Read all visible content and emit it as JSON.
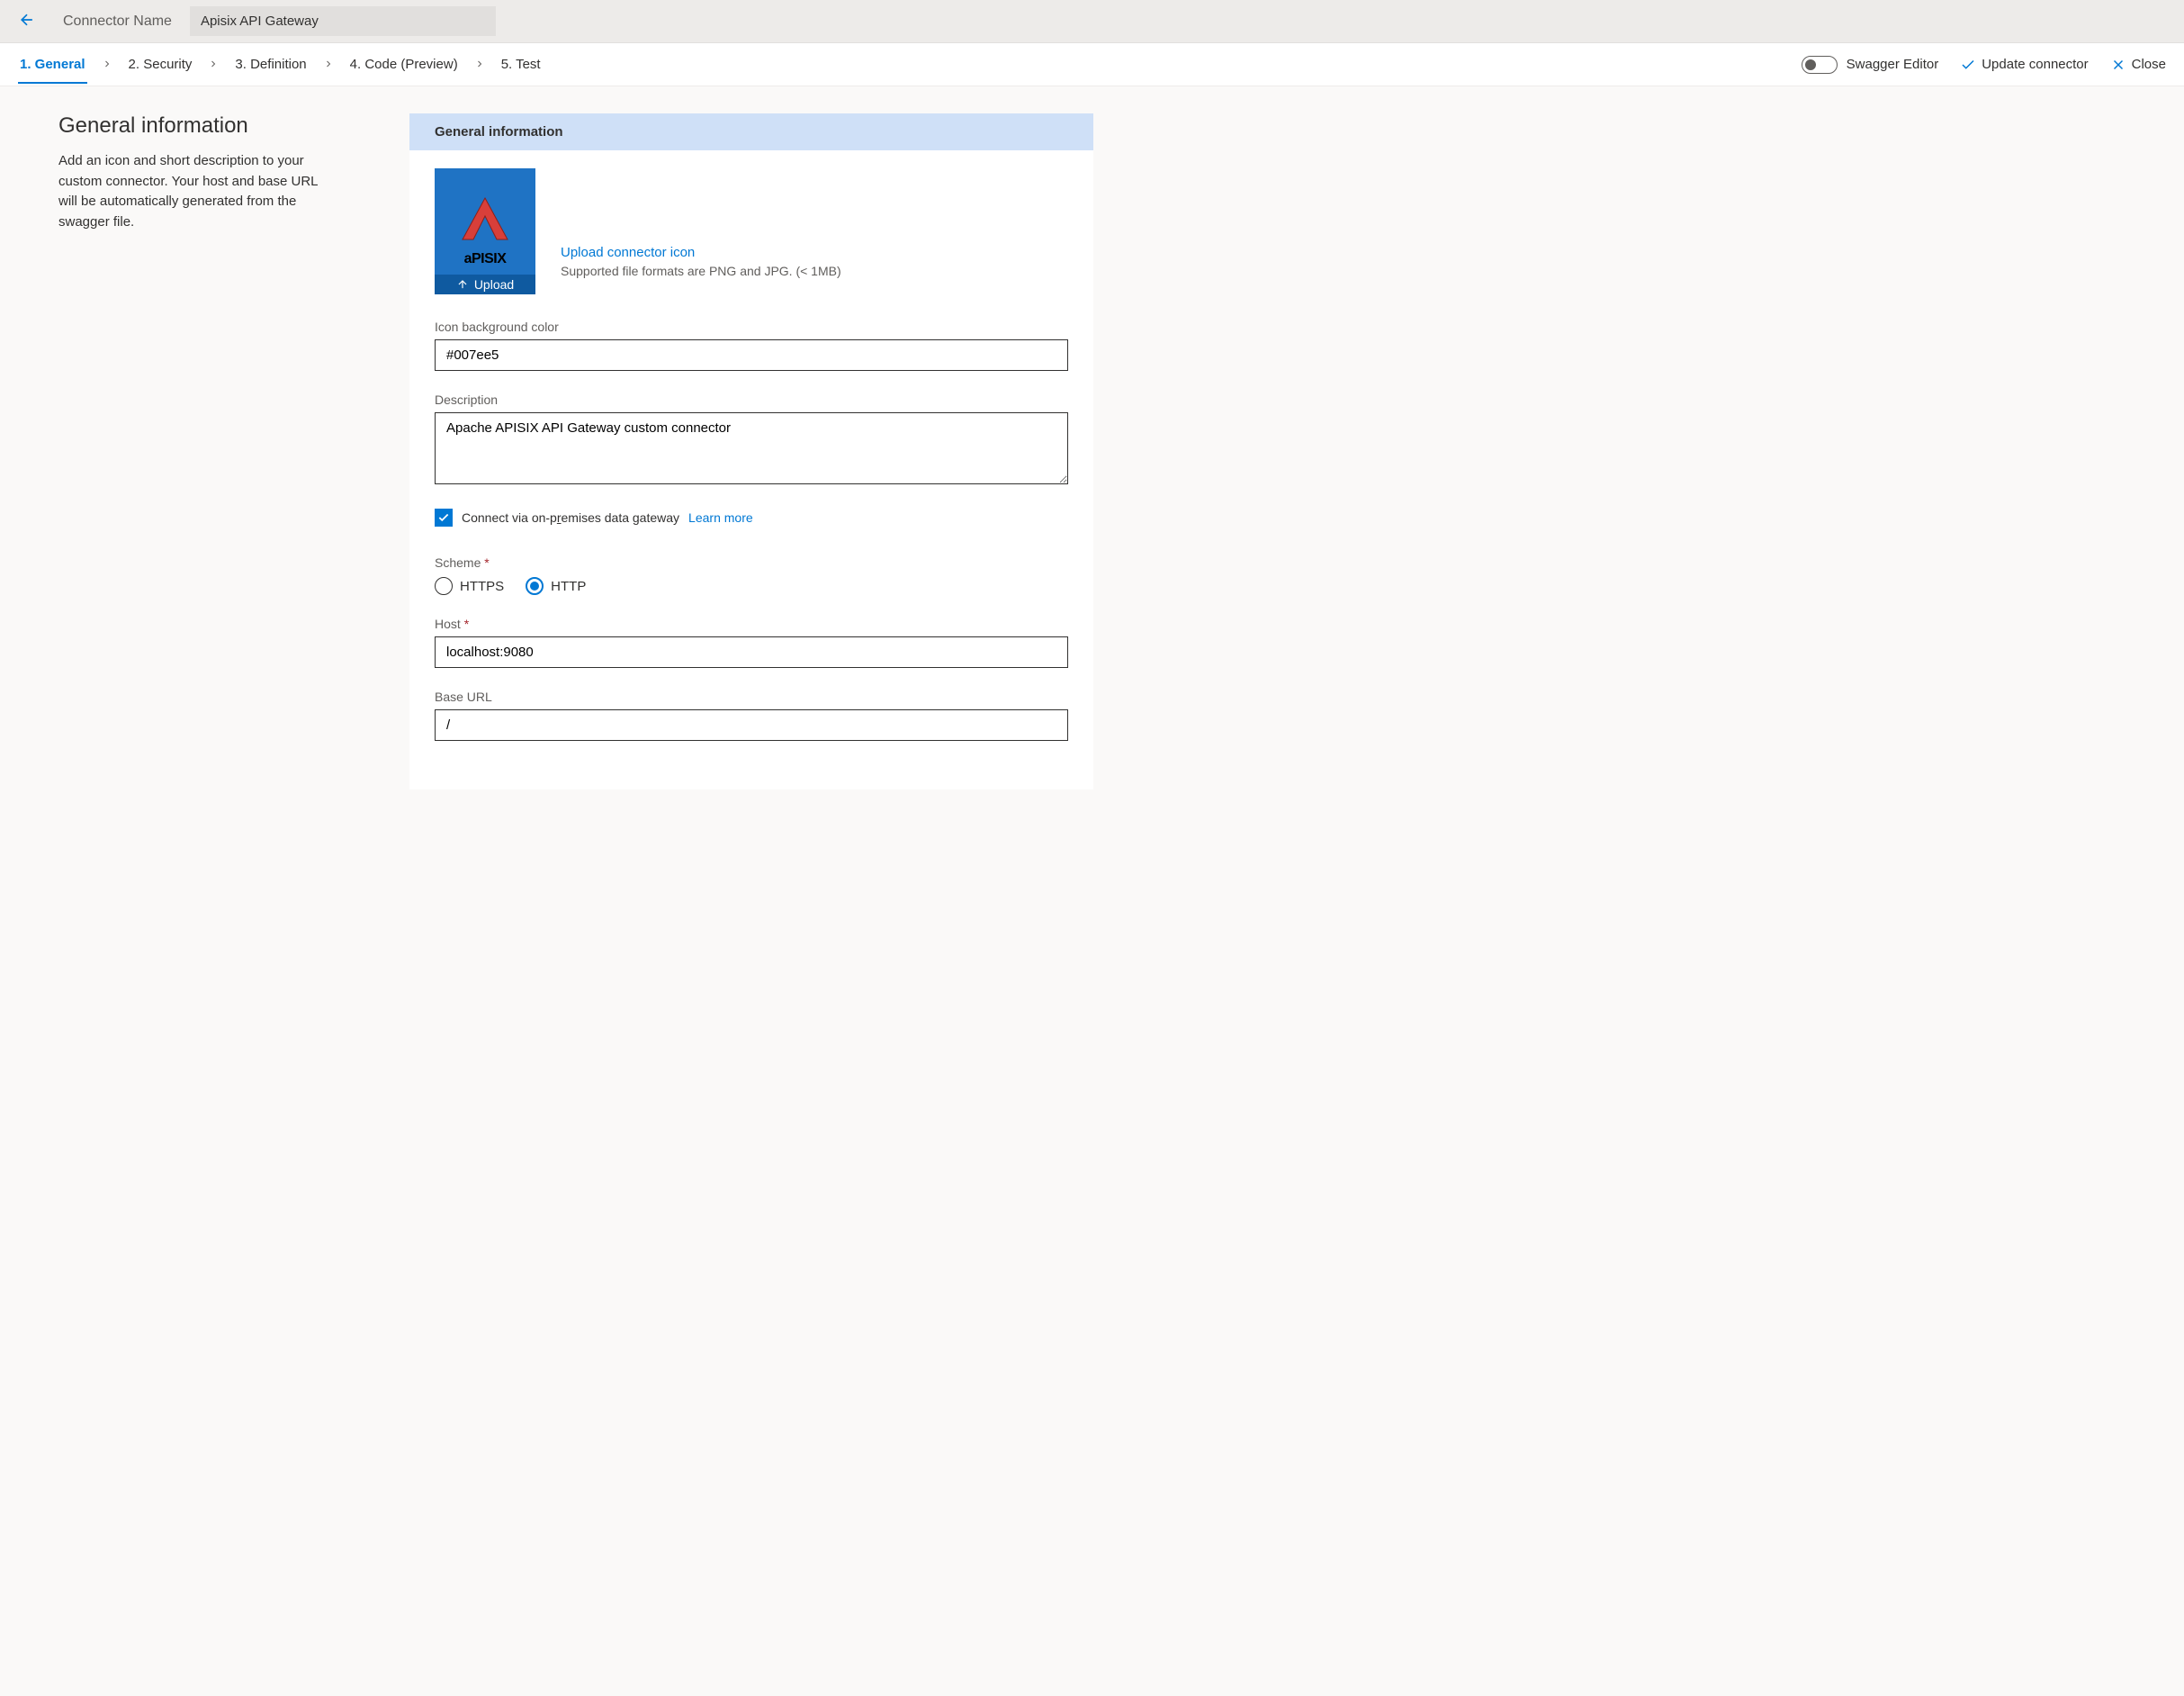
{
  "header": {
    "connector_name_label": "Connector Name",
    "connector_name_value": "Apisix API Gateway"
  },
  "tabs": {
    "general": "1. General",
    "security": "2. Security",
    "definition": "3. Definition",
    "code": "4. Code (Preview)",
    "test": "5. Test"
  },
  "actions": {
    "swagger_editor": "Swagger Editor",
    "update_connector": "Update connector",
    "close": "Close"
  },
  "left": {
    "heading": "General information",
    "description": "Add an icon and short description to your custom connector. Your host and base URL will be automatically generated from the swagger file."
  },
  "form": {
    "section_title": "General information",
    "upload_label": "Upload",
    "upload_link": "Upload connector icon",
    "upload_hint": "Supported file formats are PNG and JPG. (< 1MB)",
    "icon_bg_label": "Icon background color",
    "icon_bg_value": "#007ee5",
    "description_label": "Description",
    "description_value": "Apache APISIX API Gateway custom connector",
    "gateway_checkbox_label_pre": "Connect via on-p",
    "gateway_checkbox_underline": "r",
    "gateway_checkbox_label_post": "emises data gateway",
    "learn_more": "Learn more",
    "scheme_label": "Scheme",
    "scheme_options": {
      "https": "HTTPS",
      "http": "HTTP"
    },
    "host_label": "Host",
    "host_value": "localhost:9080",
    "base_url_label": "Base URL",
    "base_url_value": "/",
    "logo_text": "aPISIX"
  }
}
